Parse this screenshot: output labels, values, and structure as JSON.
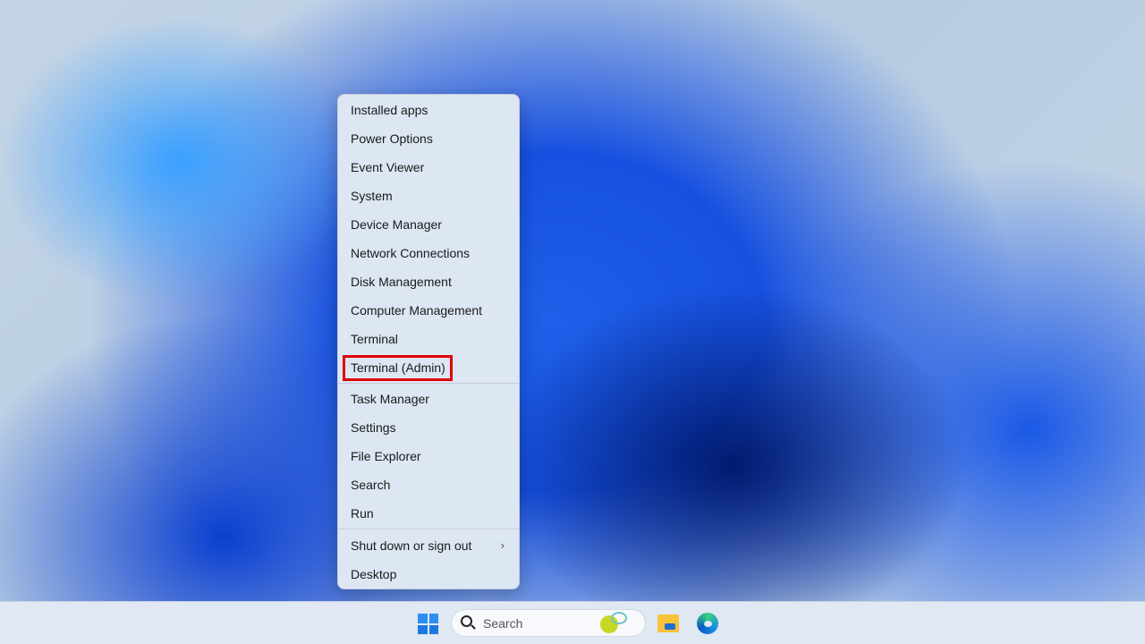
{
  "context_menu": {
    "group1": [
      "Installed apps",
      "Power Options",
      "Event Viewer",
      "System",
      "Device Manager",
      "Network Connections",
      "Disk Management",
      "Computer Management",
      "Terminal",
      "Terminal (Admin)"
    ],
    "group2": [
      "Task Manager",
      "Settings",
      "File Explorer",
      "Search",
      "Run"
    ],
    "group3": [
      "Shut down or sign out",
      "Desktop"
    ],
    "highlighted": "Terminal (Admin)",
    "highlight_color": "#e00000"
  },
  "taskbar": {
    "search_placeholder": "Search",
    "icons": [
      "windows-start-icon",
      "search-icon",
      "tennis-icon",
      "file-explorer-icon",
      "edge-icon"
    ]
  }
}
